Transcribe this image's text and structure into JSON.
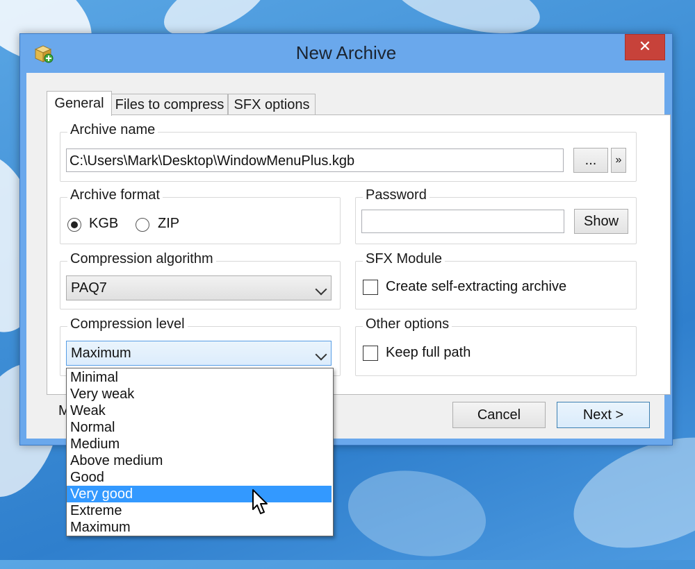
{
  "window": {
    "title": "New Archive",
    "close_label": "✕"
  },
  "tabs": [
    {
      "label": "General"
    },
    {
      "label": "Files to compress"
    },
    {
      "label": "SFX options"
    }
  ],
  "archive_name": {
    "label": "Archive name",
    "value": "C:\\Users\\Mark\\Desktop\\WindowMenuPlus.kgb",
    "browse_label": "...",
    "more_label": "»"
  },
  "archive_format": {
    "label": "Archive format",
    "options": [
      "KGB",
      "ZIP"
    ],
    "selected": "KGB"
  },
  "password": {
    "label": "Password",
    "value": "",
    "show_label": "Show"
  },
  "compression_algorithm": {
    "label": "Compression algorithm",
    "value": "PAQ7"
  },
  "sfx_module": {
    "label": "SFX Module",
    "checkbox_label": "Create self-extracting archive",
    "checked": false
  },
  "compression_level": {
    "label": "Compression level",
    "value": "Maximum",
    "options": [
      "Minimal",
      "Very weak",
      "Weak",
      "Normal",
      "Medium",
      "Above medium",
      "Good",
      "Very good",
      "Extreme",
      "Maximum"
    ],
    "highlighted": "Very good"
  },
  "other_options": {
    "label": "Other options",
    "checkbox_label": "Keep full path",
    "checked": false
  },
  "footer": {
    "partial_label": "M",
    "cancel_label": "Cancel",
    "next_label": "Next >"
  }
}
